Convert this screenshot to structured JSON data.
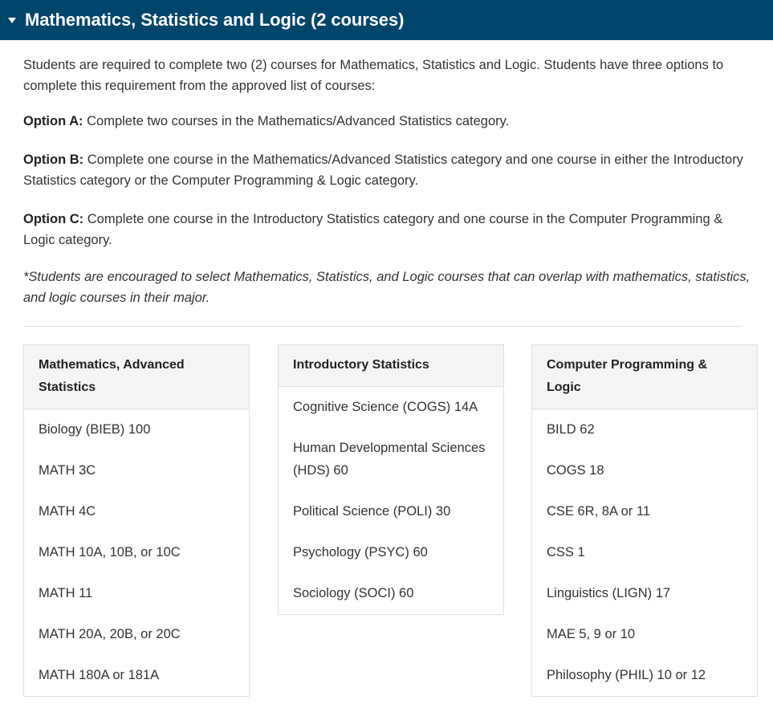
{
  "accordion": {
    "toggle_icon": "triangle-down-icon",
    "title": "Mathematics, Statistics and Logic (2 courses)",
    "expanded": true,
    "header_color": "#00456b",
    "header_text_color": "#ffffff"
  },
  "body": {
    "intro": "Students are required to complete two (2) courses for Mathematics, Statistics and Logic. Students have three options to complete this requirement from the approved list of courses:",
    "option_a_label": "Option A:",
    "option_a_text": " Complete two courses in the Mathematics/Advanced Statistics category.",
    "option_b_label": "Option B:",
    "option_b_text": " Complete one course in the Mathematics/Advanced Statistics category and one course in either the Introductory Statistics category or the Computer Programming & Logic category.",
    "option_c_label": "Option C:",
    "option_c_text": " Complete one course in the Introductory Statistics category and one course in the Computer Programming & Logic category.",
    "note": "*Students are encouraged to select Mathematics, Statistics, and Logic courses that can overlap with mathematics, statistics, and logic courses in their major."
  },
  "tables": [
    {
      "header": "Mathematics, Advanced Statistics",
      "rows": [
        "Biology (BIEB) 100",
        "MATH 3C",
        "MATH 4C",
        "MATH 10A, 10B, or 10C",
        "MATH 11",
        "MATH 20A, 20B, or 20C",
        "MATH 180A or 181A"
      ]
    },
    {
      "header": "Introductory Statistics",
      "rows": [
        "Cognitive Science (COGS) 14A",
        "Human Developmental Sciences (HDS) 60",
        "Political Science (POLI) 30",
        "Psychology (PSYC) 60",
        "Sociology (SOCI) 60"
      ]
    },
    {
      "header": "Computer Programming & Logic",
      "rows": [
        "BILD 62",
        "COGS 18",
        "CSE 6R, 8A or 11",
        "CSS 1",
        "Linguistics (LIGN) 17",
        "MAE 5, 9 or 10",
        "Philosophy (PHIL) 10 or 12"
      ]
    }
  ]
}
